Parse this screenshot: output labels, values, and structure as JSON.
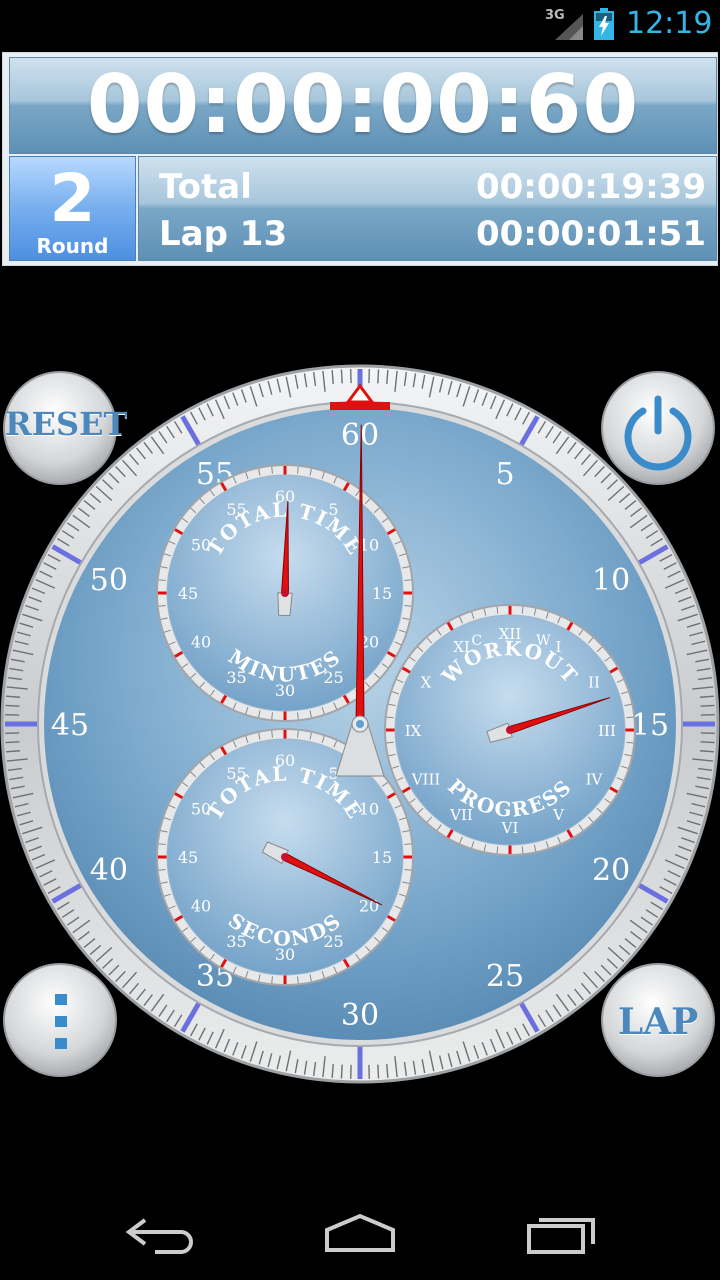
{
  "status_bar": {
    "network": "3G",
    "clock": "12:19"
  },
  "header": {
    "main_time": "00:00:00:60",
    "round_number": "2",
    "round_label": "Round",
    "total_label": "Total",
    "total_value": "00:00:19:39",
    "lap_label": "Lap 13",
    "lap_value": "00:00:01:51"
  },
  "dial": {
    "outer_numbers": [
      "60",
      "5",
      "10",
      "15",
      "20",
      "25",
      "30",
      "35",
      "40",
      "45",
      "50",
      "55"
    ],
    "minutes_subdial": {
      "title": "TOTAL TIME",
      "label": "MINUTES",
      "numbers": [
        "60",
        "5",
        "10",
        "15",
        "20",
        "25",
        "30",
        "35",
        "40",
        "45",
        "50",
        "55"
      ]
    },
    "seconds_subdial": {
      "title": "TOTAL TIME",
      "label": "SECONDS",
      "numbers": [
        "60",
        "5",
        "10",
        "15",
        "20",
        "25",
        "30",
        "35",
        "40",
        "45",
        "50",
        "55"
      ]
    },
    "workout_subdial": {
      "title": "WORKOUT",
      "label": "PROGRESS",
      "top_letters": [
        "C",
        "W"
      ],
      "roman": [
        "I",
        "II",
        "III",
        "IV",
        "V",
        "VI",
        "VII",
        "VIII",
        "IX",
        "X",
        "XI",
        "XII"
      ]
    },
    "hands": {
      "main_seconds_value": 0.6,
      "minutes_value": 0.3,
      "seconds_value": 19.39,
      "workout_fraction": 0.18
    },
    "colors": {
      "face": "#6e9ec4",
      "bezel": "#d8dadc",
      "hand": "#e01010",
      "accent_tick": "#6a70e0"
    }
  },
  "buttons": {
    "reset_label": "RESET",
    "lap_label": "LAP",
    "power_icon": "power-icon",
    "menu_icon": "overflow-menu-icon"
  },
  "nav_bar": {
    "back_icon": "back-icon",
    "home_icon": "home-icon",
    "recents_icon": "recents-icon"
  }
}
